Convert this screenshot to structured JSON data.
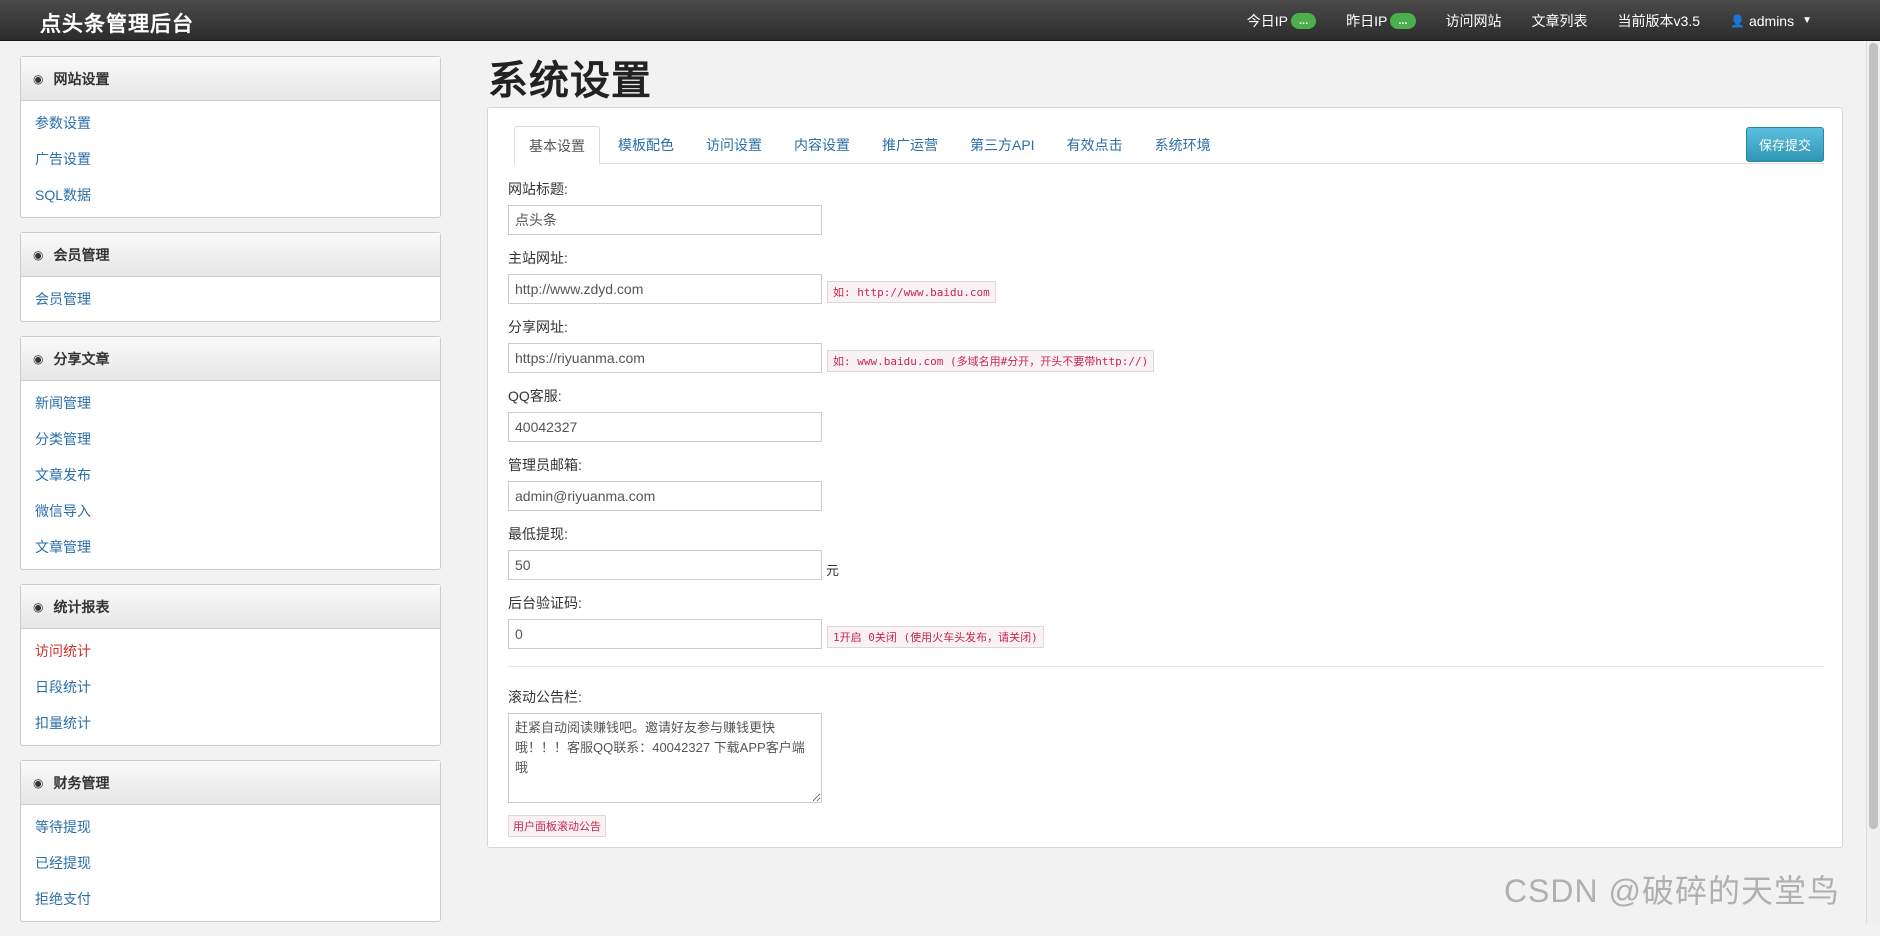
{
  "navbar": {
    "brand": "点头条管理后台",
    "today_ip_label": "今日IP",
    "today_ip_badge": "...",
    "yesterday_ip_label": "昨日IP",
    "yesterday_ip_badge": "...",
    "visit_site": "访问网站",
    "article_list": "文章列表",
    "version": "当前版本v3.5",
    "user": "admins"
  },
  "sidebar": {
    "groups": [
      {
        "title": "网站设置",
        "items": [
          "参数设置",
          "广告设置",
          "SQL数据"
        ]
      },
      {
        "title": "会员管理",
        "items": [
          "会员管理"
        ]
      },
      {
        "title": "分享文章",
        "items": [
          "新闻管理",
          "分类管理",
          "文章发布",
          "微信导入",
          "文章管理"
        ]
      },
      {
        "title": "统计报表",
        "items": [
          "访问统计",
          "日段统计",
          "扣量统计"
        ]
      },
      {
        "title": "财务管理",
        "items": [
          "等待提现",
          "已经提现",
          "拒绝支付"
        ]
      }
    ]
  },
  "main": {
    "title": "系统设置",
    "tabs": [
      "基本设置",
      "模板配色",
      "访问设置",
      "内容设置",
      "推广运营",
      "第三方API",
      "有效点击",
      "系统环境"
    ],
    "save_button": "保存提交",
    "fields": {
      "site_title": {
        "label": "网站标题:",
        "value": "点头条"
      },
      "main_url": {
        "label": "主站网址:",
        "value": "http://www.zdyd.com",
        "hint": "如: http://www.baidu.com"
      },
      "share_url": {
        "label": "分享网址:",
        "value": "https://riyuanma.com",
        "hint": "如: www.baidu.com (多域名用#分开，开头不要带http://)"
      },
      "qq": {
        "label": "QQ客服:",
        "value": "40042327"
      },
      "email": {
        "label": "管理员邮箱:",
        "value": "admin@riyuanma.com"
      },
      "min_withdraw": {
        "label": "最低提现:",
        "value": "50",
        "unit": "元"
      },
      "captcha": {
        "label": "后台验证码:",
        "value": "0",
        "hint": "1开启 0关闭 (使用火车头发布，请关闭)"
      },
      "notice": {
        "label": "滚动公告栏:",
        "value": "赶紧自动阅读赚钱吧。邀请好友参与赚钱更快哦！！！客服QQ联系：40042327 下载APP客户端哦",
        "hint": "用户面板滚动公告"
      }
    }
  },
  "watermark": "CSDN @破碎的天堂鸟"
}
